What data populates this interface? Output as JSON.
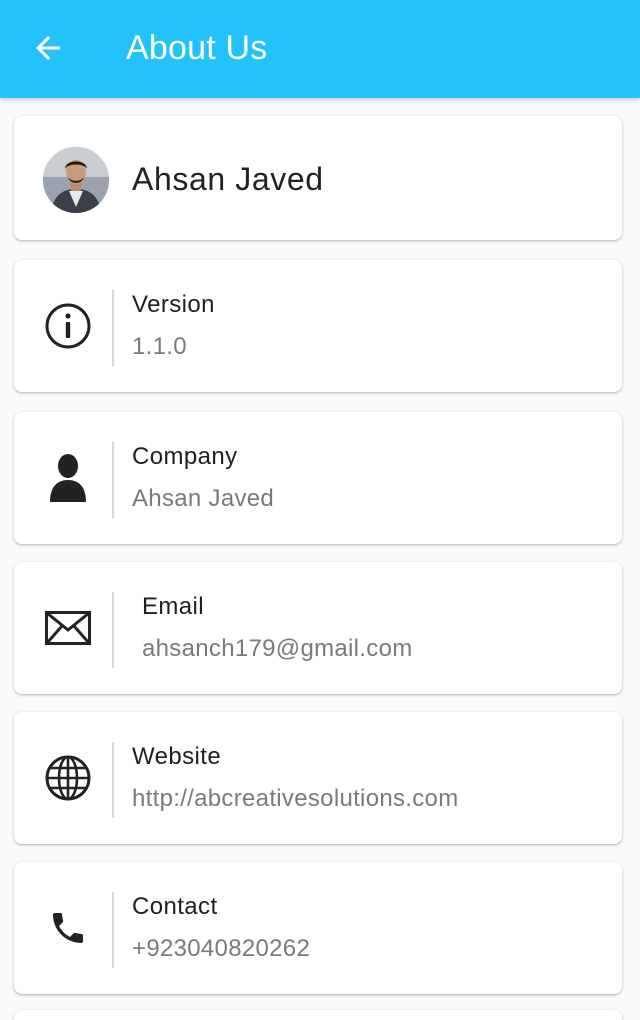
{
  "appbar": {
    "title": "About Us",
    "back_icon": "arrow-left-icon",
    "background": "#23c2fb"
  },
  "profile": {
    "name": "Ahsan Javed",
    "avatar_icon": "avatar"
  },
  "info_items": [
    {
      "icon": "info-icon",
      "label": "Version",
      "value": "1.1.0"
    },
    {
      "icon": "person-icon",
      "label": "Company",
      "value": "Ahsan Javed"
    },
    {
      "icon": "envelope-icon",
      "label": "Email",
      "value": "ahsanch179@gmail.com"
    },
    {
      "icon": "globe-icon",
      "label": "Website",
      "value": "http://abcreativesolutions.com"
    },
    {
      "icon": "phone-icon",
      "label": "Contact",
      "value": "+923040820262"
    }
  ]
}
